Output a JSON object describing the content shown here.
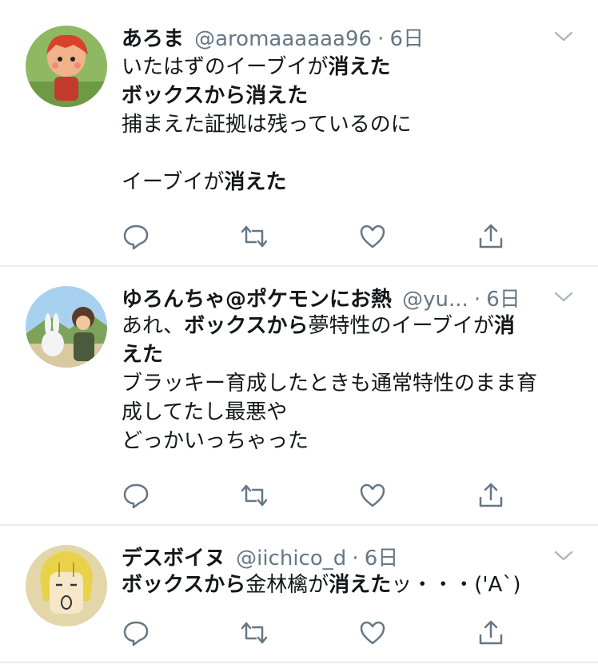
{
  "tweets": [
    {
      "name": "あろま",
      "handle": "@aromaaaaaa96",
      "dot": "·",
      "time": "6日",
      "lines": [
        {
          "a": "いたはずのイーブイが",
          "b": "消えた",
          "c": ""
        },
        {
          "a": "",
          "b": "ボックスから消えた",
          "c": ""
        },
        {
          "a": "捕まえた証拠は残っているのに",
          "b": "",
          "c": ""
        },
        {
          "a": "",
          "b": "",
          "c": ""
        },
        {
          "a": "イーブイが",
          "b": "消えた",
          "c": ""
        }
      ]
    },
    {
      "name": "ゆろんちゃ@ポケモンにお熱",
      "handle": "@yu...",
      "dot": "·",
      "time": "6日",
      "lines": [
        {
          "a": "あれ、",
          "b": "ボックスから",
          "c": "夢特性のイーブイが",
          "d": "消"
        },
        {
          "a": "",
          "b": "えた",
          "c": "",
          "d": ""
        },
        {
          "a": "ブラッキー育成したときも通常特性のまま育",
          "b": "",
          "c": "",
          "d": ""
        },
        {
          "a": "成してたし最悪や",
          "b": "",
          "c": "",
          "d": ""
        },
        {
          "a": "どっかいっちゃった",
          "b": "",
          "c": "",
          "d": ""
        }
      ]
    },
    {
      "name": "デスボイヌ",
      "handle": "@iichico_d",
      "dot": "·",
      "time": "6日",
      "lines": [
        {
          "a": "",
          "b": "ボックスから",
          "c": "金林檎が",
          "d": "消えた",
          "e": "ッ・・・('A`)"
        }
      ]
    }
  ],
  "icons": [
    "reply-icon",
    "retweet-icon",
    "like-icon",
    "share-icon",
    "chevron-down-icon"
  ],
  "colors": {
    "icon_gray": "#657786",
    "border": "#e6ecf0",
    "text": "#14171a"
  }
}
